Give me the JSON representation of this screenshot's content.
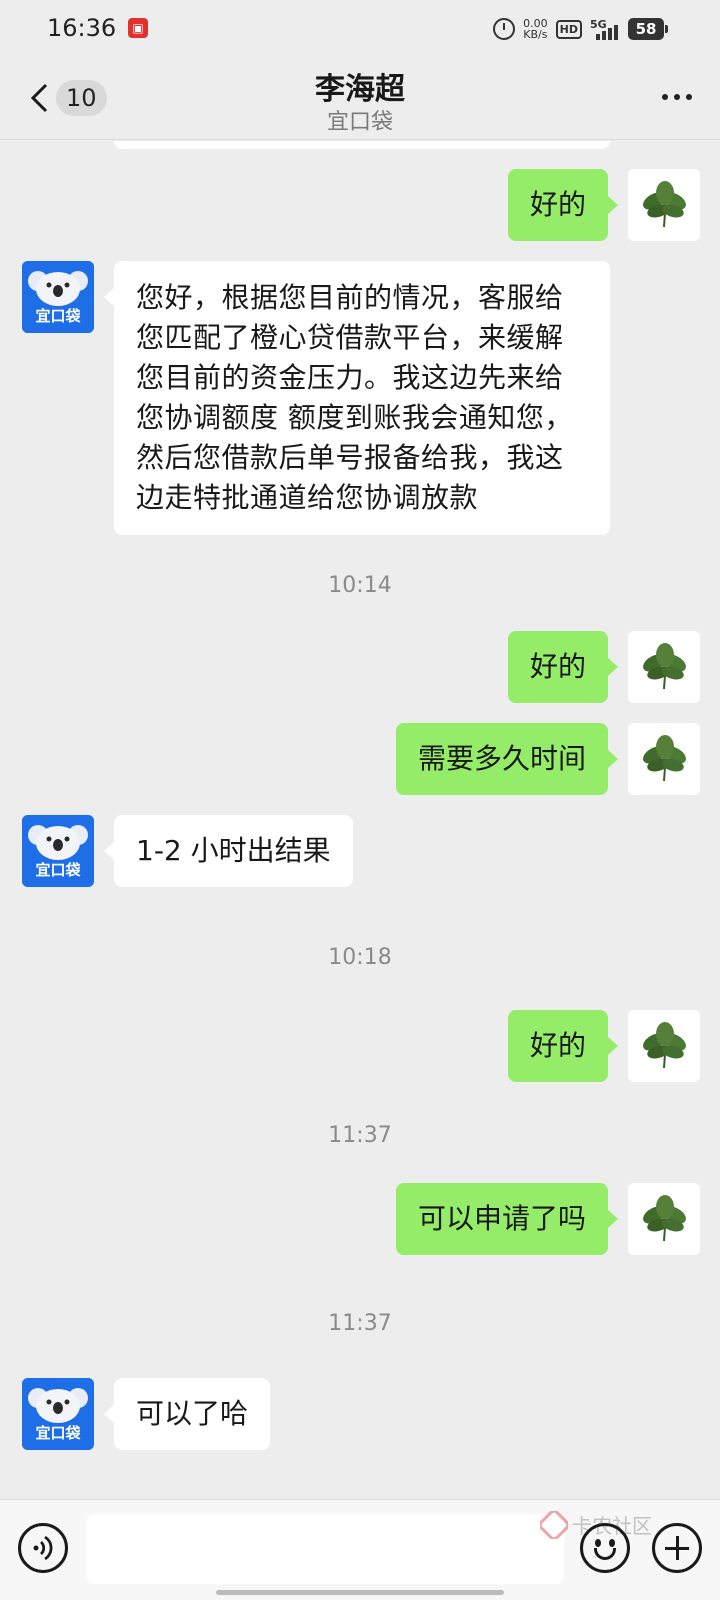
{
  "status_bar": {
    "time": "16:36",
    "net_speed_value": "0.00",
    "net_speed_unit": "KB/s",
    "hd_label": "HD",
    "network_label": "5G",
    "battery": "58"
  },
  "header": {
    "unread_count": "10",
    "title": "李海超",
    "subtitle": "宜口袋"
  },
  "bot_avatar_text": "宜口袋",
  "messages": [
    {
      "type": "text",
      "from": "me",
      "text": "好的"
    },
    {
      "type": "text",
      "from": "bot",
      "text": "您好，根据您目前的情况，客服给您匹配了橙心贷借款平台，来缓解您目前的资金压力。我这边先来给您协调额度 额度到账我会通知您，然后您借款后单号报备给我，我这边走特批通道给您协调放款"
    },
    {
      "type": "time",
      "text": "10:14"
    },
    {
      "type": "text",
      "from": "me",
      "text": "好的"
    },
    {
      "type": "text",
      "from": "me",
      "text": "需要多久时间"
    },
    {
      "type": "text",
      "from": "bot",
      "text": "1-2 小时出结果"
    },
    {
      "type": "time",
      "text": "10:18"
    },
    {
      "type": "text",
      "from": "me",
      "text": "好的"
    },
    {
      "type": "time",
      "text": "11:37"
    },
    {
      "type": "text",
      "from": "me",
      "text": "可以申请了吗"
    },
    {
      "type": "time",
      "text": "11:37"
    },
    {
      "type": "text",
      "from": "bot",
      "text": "可以了哈"
    }
  ],
  "input_bar": {
    "placeholder": "",
    "watermark": "卡农社区"
  },
  "colors": {
    "my_bubble": "#95ec69",
    "bot_bubble": "#ffffff",
    "bot_avatar": "#1e6ee8",
    "background": "#ededed"
  }
}
